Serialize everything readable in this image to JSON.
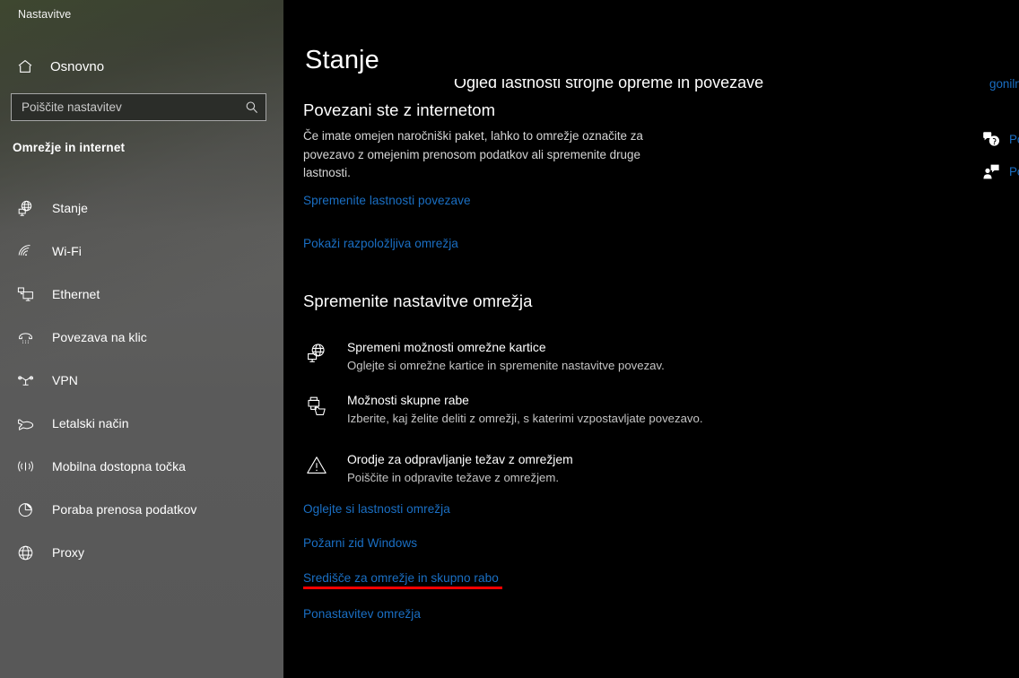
{
  "window": {
    "title": "Nastavitve"
  },
  "sidebar": {
    "home": {
      "label": "Osnovno",
      "icon": "home-icon"
    },
    "search": {
      "placeholder": "Poiščite nastavitev",
      "value": "",
      "icon": "search-icon"
    },
    "section_label": "Omrežje in internet",
    "items": [
      {
        "label": "Stanje",
        "icon": "globe-monitor-icon",
        "selected": true
      },
      {
        "label": "Wi-Fi",
        "icon": "wifi-icon",
        "selected": false
      },
      {
        "label": "Ethernet",
        "icon": "ethernet-icon",
        "selected": false
      },
      {
        "label": "Povezava na klic",
        "icon": "dialup-phone-icon",
        "selected": false
      },
      {
        "label": "VPN",
        "icon": "vpn-icon",
        "selected": false
      },
      {
        "label": "Letalski način",
        "icon": "airplane-icon",
        "selected": false
      },
      {
        "label": "Mobilna dostopna točka",
        "icon": "hotspot-icon",
        "selected": false
      },
      {
        "label": "Poraba prenosa podatkov",
        "icon": "data-usage-pie-icon",
        "selected": false
      },
      {
        "label": "Proxy",
        "icon": "globe-icon",
        "selected": false
      }
    ]
  },
  "main": {
    "page_title": "Stanje",
    "clipped_fragment": "Ogled lastnosti strojne opreme in povezave",
    "status": {
      "heading": "Povezani ste z internetom",
      "description": "Če imate omejen naročniški paket, lahko to omrežje označite za povezavo z omejenim prenosom podatkov ali spremenite druge lastnosti.",
      "link_properties": "Spremenite lastnosti povezave",
      "link_available_networks": "Pokaži razpoložljiva omrežja"
    },
    "section_heading": "Spremenite nastavitve omrežja",
    "options": [
      {
        "title": "Spremeni možnosti omrežne kartice",
        "desc": "Oglejte si omrežne kartice in spremenite nastavitve povezav.",
        "icon": "globe-monitor-icon"
      },
      {
        "title": "Možnosti skupne rabe",
        "desc": "Izberite, kaj želite deliti z omrežji, s katerimi vzpostavljate povezavo.",
        "icon": "printer-folder-sharing-icon"
      },
      {
        "title": "Orodje za odpravljanje težav z omrežjem",
        "desc": "Poiščite in odpravite težave z omrežjem.",
        "icon": "warning-triangle-icon"
      }
    ],
    "links": [
      "Oglejte si lastnosti omrežja",
      "Požarni zid Windows",
      "Središče za omrežje in skupno rabo",
      "Ponastavitev omrežja"
    ]
  },
  "right_rail": {
    "clipped_link": "gonilnik",
    "help": {
      "label": "Pomoč",
      "icon": "help-bubble-icon"
    },
    "feedback": {
      "label": "Pošljite povratne informacije",
      "icon": "feedback-person-icon"
    }
  },
  "annotation": {
    "type": "red-underline",
    "color": "#ff0000",
    "targets_link": "Središče za omrežje in skupno rabo"
  },
  "colors": {
    "link": "#1a6fc4",
    "background": "#000000",
    "sidebar": "#5a5a5a",
    "annotation": "#ff0000"
  }
}
